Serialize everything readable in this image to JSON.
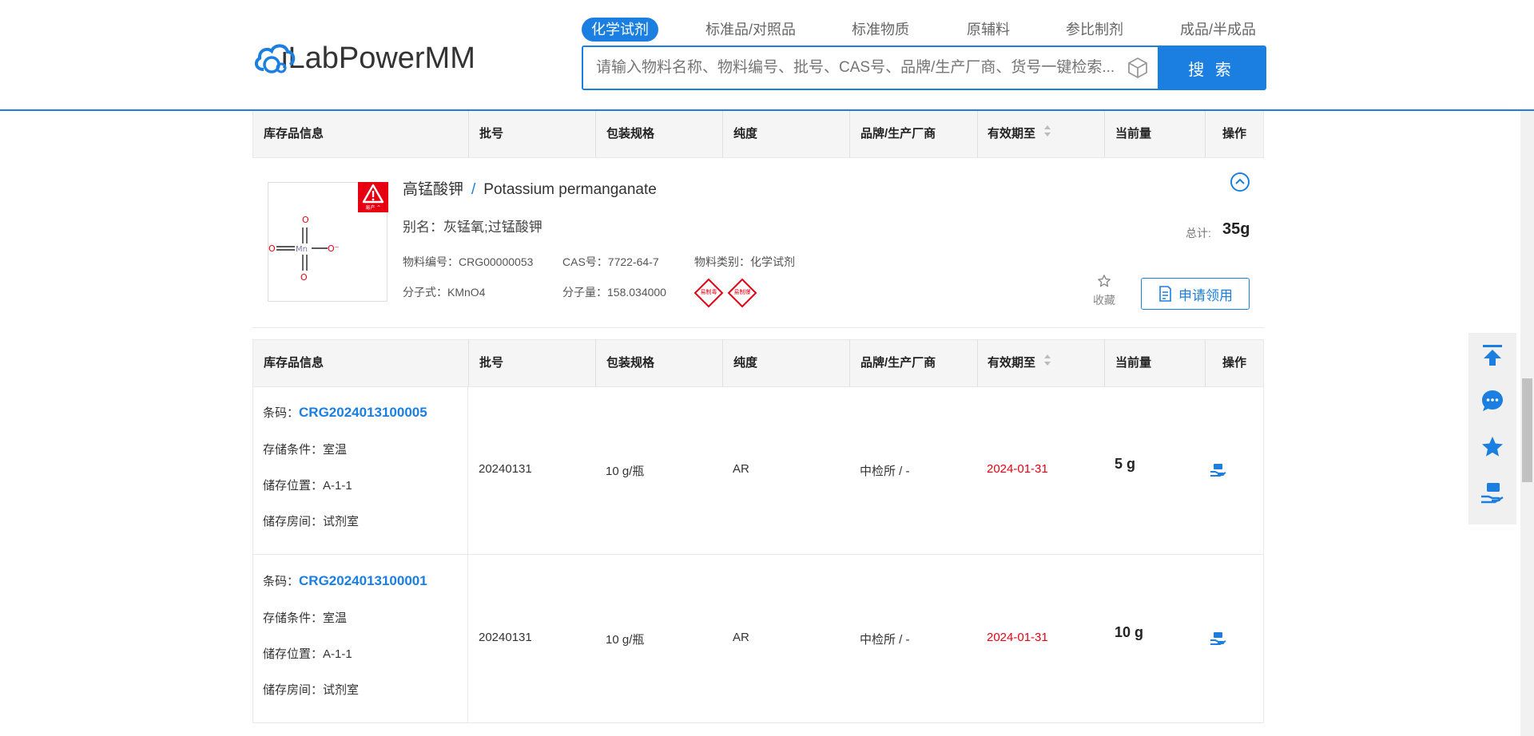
{
  "header": {
    "logo_text": "iLabPowerMM",
    "categories": [
      "化学试剂",
      "标准品/对照品",
      "标准物质",
      "原辅料",
      "参比制剂",
      "成品/半成品"
    ],
    "search_placeholder": "请输入物料名称、物料编号、批号、CAS号、品牌/生产厂商、货号一键检索...",
    "search_button": "搜 索"
  },
  "table_headers": [
    "库存品信息",
    "批号",
    "包装规格",
    "纯度",
    "品牌/生产厂商",
    "有效期至",
    "当前量",
    "操作"
  ],
  "product": {
    "name_cn": "高锰酸钾",
    "separator": "/",
    "name_en": "Potassium permanganate",
    "alias": "别名：灰锰氧;过锰酸钾",
    "code": "物料编号：CRG00000053",
    "cas": "CAS号：7722-64-7",
    "category": "物料类别：化学试剂",
    "formula": "分子式：KMnO4",
    "weight": "分子量：158.034000",
    "ghs_labels": [
      "易制毒",
      "易制爆"
    ],
    "hazard_label": "易产 ^",
    "total_label": "总计:",
    "total_value": "35g",
    "favorite_label": "收藏",
    "apply_label": "申请领用",
    "molecule_atoms": [
      "O",
      "Mn",
      "O",
      "O",
      "O⁻"
    ]
  },
  "inventory": [
    {
      "barcode_label": "条码：",
      "barcode": "CRG2024013100005",
      "storage": "存储条件：室温",
      "location": "储存位置：A-1-1",
      "room": "储存房间：试剂室",
      "batch": "20240131",
      "spec": "10 g/瓶",
      "purity": "AR",
      "brand": "中检所 / -",
      "expiry": "2024-01-31",
      "qty": "5 g"
    },
    {
      "barcode_label": "条码：",
      "barcode": "CRG2024013100001",
      "storage": "存储条件：室温",
      "location": "储存位置：A-1-1",
      "room": "储存房间：试剂室",
      "batch": "20240131",
      "spec": "10 g/瓶",
      "purity": "AR",
      "brand": "中检所 / -",
      "expiry": "2024-01-31",
      "qty": "10 g"
    }
  ],
  "colors": {
    "accent": "#1a7fe0",
    "danger": "#e60012"
  }
}
